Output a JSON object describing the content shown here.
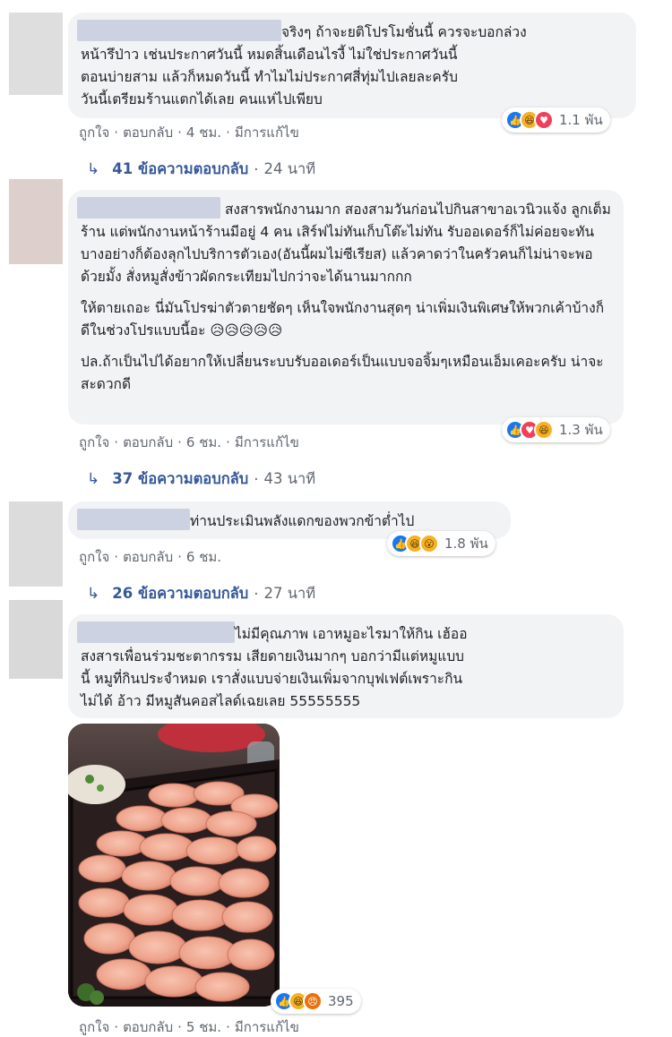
{
  "comments": [
    {
      "text_lines": [
        "จริงๆ ถ้าจะยติโปรโมชั่นนี้ ควรจะบอกล่วง",
        "หน้ารึป่าว เช่นประกาศวันนี้ หมดสิ้นเดือนไรงี้ ไม่ใช่ประกาศวันนี้",
        "ตอนบ่ายสาม แล้วก็หมดวันนี้ ทำไมไม่ประกาศสี่ทุ่มไปเลยละครับ",
        "วันนี้เตรียมร้านแตกได้เลย คนแห่ไปเพียบ"
      ],
      "reactions": {
        "count": "1.1 พัน",
        "icons": [
          "like-icon",
          "haha-icon",
          "love-icon"
        ]
      },
      "actions": {
        "like": "ถูกใจ",
        "reply": "ตอบกลับ",
        "time": "4 ชม.",
        "edited": "มีการแก้ไข"
      },
      "reply_summary": {
        "count": "41 ข้อความตอบกลับ",
        "time": "24 นาที"
      }
    },
    {
      "paragraphs": [
        "สงสารพนักงานมาก สองสามวันก่อนไปกินสาขาอเวนิวแจ้ง ลูกเต็มร้าน แต่พนักงานหน้าร้านมีอยู่ 4 คน เสิร์ฟไม่ทันเก็บโต๊ะไม่ทัน รับออเดอร์ก็ไม่ค่อยจะทัน บางอย่างก็ต้องลุกไปบริการตัวเอง(อันนี้ผมไม่ซีเรียส) แล้วคาดว่าในครัวคนก็ไม่น่าจะพอด้วยมั้ง สั่งหมูสั่งข้าวผัดกระเทียมไปกว่าจะได้นานมากกก",
        "ให้ตายเถอะ นี่มันโปรฆ่าตัวตายชัดๆ เห็นใจพนักงานสุดๆ น่าเพิ่มเงินพิเศษให้พวกเค้าบ้างก็ดีในช่วงโปรแบบนี้อะ 😥😥😥😥😥",
        "ปล.ถ้าเป็นไปได้อยากให้เปลี่ยนระบบรับออเดอร์เป็นแบบจอจิ้มๆเหมือนเอ็มเคอะครับ น่าจะสะดวกดี"
      ],
      "reactions": {
        "count": "1.3 พัน",
        "icons": [
          "like-icon",
          "love-icon",
          "haha-icon"
        ]
      },
      "actions": {
        "like": "ถูกใจ",
        "reply": "ตอบกลับ",
        "time": "6 ชม.",
        "edited": "มีการแก้ไข"
      },
      "reply_summary": {
        "count": "37 ข้อความตอบกลับ",
        "time": "43 นาที"
      }
    },
    {
      "text": "ท่านประเมินพลังแดกของพวกข้าต่ำไป",
      "reactions": {
        "count": "1.8 พัน",
        "icons": [
          "like-icon",
          "haha-icon",
          "wow-icon"
        ]
      },
      "actions": {
        "like": "ถูกใจ",
        "reply": "ตอบกลับ",
        "time": "6 ชม."
      },
      "reply_summary": {
        "count": "26 ข้อความตอบกลับ",
        "time": "27 นาที"
      }
    },
    {
      "text_lines": [
        "ไม่มีคุณภาพ เอาหมูอะไรมาให้กิน เฮ้ออ",
        "สงสารเพื่อนร่วมชะตากรรม เสียดายเงินมากๆ บอกว่ามีแต่หมูแบบ",
        "นี้ หมูที่กินประจำหมด เราสั่งแบบจ่ายเงินเพิ่มจากบุฟเฟต์เพราะกิน",
        "ไม่ได้ อ้าว มีหมูสันคอสไลด์เฉยเลย 55555555"
      ],
      "reactions": {
        "count": "395",
        "icons": [
          "like-icon",
          "haha-icon",
          "angry-icon"
        ]
      },
      "actions": {
        "like": "ถูกใจ",
        "reply": "ตอบกลับ",
        "time": "5 ชม.",
        "edited": "มีการแก้ไข"
      }
    }
  ],
  "colors": {
    "bubble": "#f2f3f5",
    "link_blue": "#365899",
    "meta_gray": "#606770",
    "like_blue": "#1877f2"
  }
}
